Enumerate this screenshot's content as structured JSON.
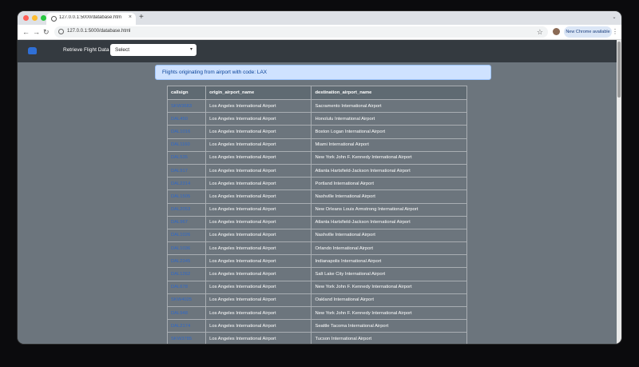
{
  "browser": {
    "tab_title": "127.0.0.1:5000/database.htm",
    "new_tab_label": "+",
    "tab_close": "×",
    "url": "127.0.0.1:5000/database.html",
    "update_button": "New Chrome available",
    "icons": [
      "back-arrow-icon",
      "forward-arrow-icon",
      "reload-icon",
      "site-info-icon",
      "bookmark-star-icon",
      "profile-icon",
      "kebab-menu-icon"
    ]
  },
  "navbar": {
    "label": "Retrieve Flight Data",
    "select_value": "Select"
  },
  "alert": {
    "text": "Flights originating from airport with code: LAX"
  },
  "table": {
    "headers": [
      "callsign",
      "origin_airport_name",
      "destination_airport_name"
    ],
    "rows": [
      {
        "callsign": "SKW3683",
        "origin": "Los Angeles International Airport",
        "destination": "Sacramento International Airport"
      },
      {
        "callsign": "DAL450",
        "origin": "Los Angeles International Airport",
        "destination": "Honolulu International Airport"
      },
      {
        "callsign": "DAL1016",
        "origin": "Los Angeles International Airport",
        "destination": "Boston Logan International Airport"
      },
      {
        "callsign": "DAL1160",
        "origin": "Los Angeles International Airport",
        "destination": "Miami International Airport"
      },
      {
        "callsign": "DAL535",
        "origin": "Los Angeles International Airport",
        "destination": "New York John F. Kennedy International Airport"
      },
      {
        "callsign": "DAL917",
        "origin": "Los Angeles International Airport",
        "destination": "Atlanta Hartsfield-Jackson International Airport"
      },
      {
        "callsign": "DAL2314",
        "origin": "Los Angeles International Airport",
        "destination": "Portland International Airport"
      },
      {
        "callsign": "DAL1505",
        "origin": "Los Angeles International Airport",
        "destination": "Nashville International Airport"
      },
      {
        "callsign": "DAL2053",
        "origin": "Los Angeles International Airport",
        "destination": "New Orleans Louis Armstrong International Airport"
      },
      {
        "callsign": "DAL967",
        "origin": "Los Angeles International Airport",
        "destination": "Atlanta Hartsfield-Jackson International Airport"
      },
      {
        "callsign": "DAL1026",
        "origin": "Los Angeles International Airport",
        "destination": "Nashville International Airport"
      },
      {
        "callsign": "DAL1036",
        "origin": "Los Angeles International Airport",
        "destination": "Orlando International Airport"
      },
      {
        "callsign": "DAL2345",
        "origin": "Los Angeles International Airport",
        "destination": "Indianapolis International Airport"
      },
      {
        "callsign": "DAL1262",
        "origin": "Los Angeles International Airport",
        "destination": "Salt Lake City International Airport"
      },
      {
        "callsign": "DAL678",
        "origin": "Los Angeles International Airport",
        "destination": "New York John F. Kennedy International Airport"
      },
      {
        "callsign": "SKW4025",
        "origin": "Los Angeles International Airport",
        "destination": "Oakland International Airport"
      },
      {
        "callsign": "DAL948",
        "origin": "Los Angeles International Airport",
        "destination": "New York John F. Kennedy International Airport"
      },
      {
        "callsign": "DAL2174",
        "origin": "Los Angeles International Airport",
        "destination": "Seattle Tacoma International Airport"
      },
      {
        "callsign": "SKW3785",
        "origin": "Los Angeles International Airport",
        "destination": "Tucson International Airport"
      }
    ]
  }
}
